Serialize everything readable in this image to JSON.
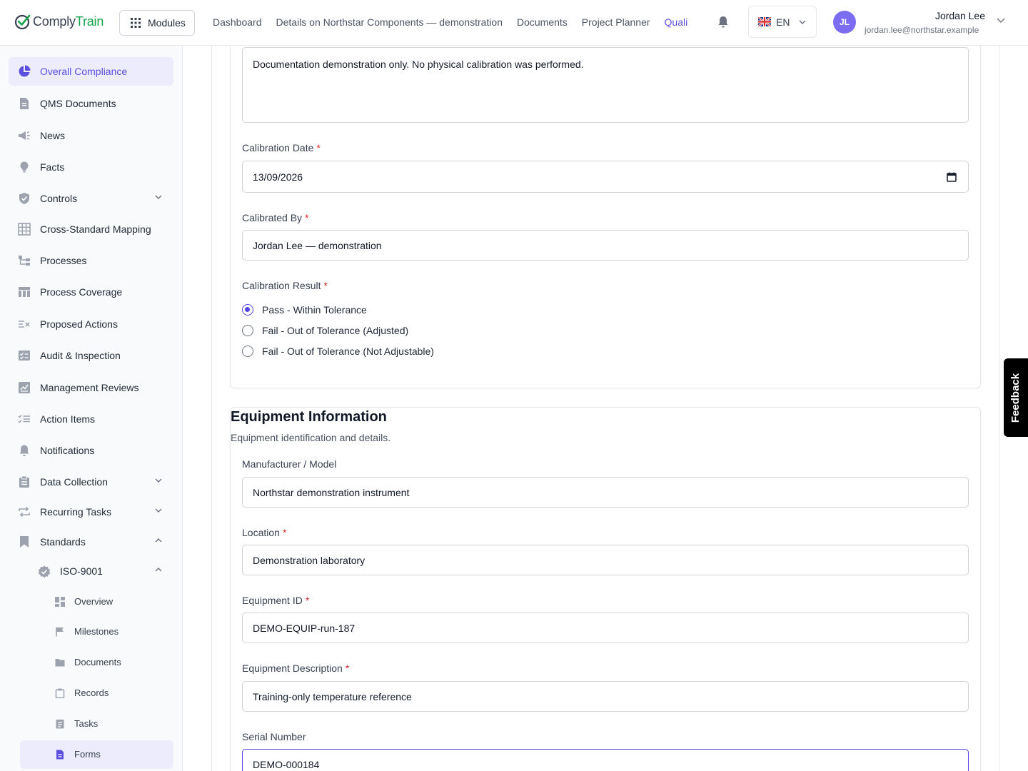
{
  "brand": {
    "name_part1": "Comply",
    "name_part2": "Train",
    "accent": "#16a34a"
  },
  "header": {
    "modules_label": "Modules",
    "nav": [
      "Dashboard",
      "Details on Northstar Components — demonstration",
      "Documents",
      "Project Planner",
      "Quali"
    ],
    "active_nav": "Quali",
    "language": "EN",
    "user": {
      "initials": "JL",
      "name": "Jordan Lee",
      "email": "jordan.lee@northstar.example"
    }
  },
  "sidebar": {
    "items": [
      {
        "label": "Overall Compliance",
        "icon": "pie-chart-icon",
        "active": true
      },
      {
        "label": "QMS Documents",
        "icon": "document-icon"
      },
      {
        "label": "News",
        "icon": "megaphone-icon"
      },
      {
        "label": "Facts",
        "icon": "lightbulb-icon"
      },
      {
        "label": "Controls",
        "icon": "shield-icon",
        "expandable": true
      },
      {
        "label": "Cross-Standard Mapping",
        "icon": "grid-icon"
      },
      {
        "label": "Processes",
        "icon": "flow-icon"
      },
      {
        "label": "Process Coverage",
        "icon": "table-icon"
      },
      {
        "label": "Proposed Actions",
        "icon": "list-x-icon"
      },
      {
        "label": "Audit & Inspection",
        "icon": "checklist-icon"
      },
      {
        "label": "Management Reviews",
        "icon": "chart-board-icon"
      },
      {
        "label": "Action Items",
        "icon": "tasks-icon"
      },
      {
        "label": "Notifications",
        "icon": "bell-icon"
      },
      {
        "label": "Data Collection",
        "icon": "clipboard-icon",
        "expandable": true
      },
      {
        "label": "Recurring Tasks",
        "icon": "repeat-icon",
        "expandable": true
      },
      {
        "label": "Standards",
        "icon": "bookmark-icon",
        "expanded": true
      }
    ],
    "standard": {
      "label": "ISO-9001",
      "icon": "badge-check-icon"
    },
    "standard_children": [
      {
        "label": "Overview",
        "icon": "dashboard-icon"
      },
      {
        "label": "Milestones",
        "icon": "flag-icon"
      },
      {
        "label": "Documents",
        "icon": "folder-icon"
      },
      {
        "label": "Records",
        "icon": "clipboard-icon"
      },
      {
        "label": "Tasks",
        "icon": "task-list-icon"
      },
      {
        "label": "Forms",
        "icon": "form-icon",
        "active": true
      }
    ]
  },
  "form": {
    "notes_value": "Documentation demonstration only. No physical calibration was performed.",
    "calibration_date": {
      "label": "Calibration Date",
      "value": "13/09/2026"
    },
    "calibrated_by": {
      "label": "Calibrated By",
      "value": "Jordan Lee — demonstration"
    },
    "calibration_result": {
      "label": "Calibration Result",
      "options": [
        "Pass - Within Tolerance",
        "Fail - Out of Tolerance (Adjusted)",
        "Fail - Out of Tolerance (Not Adjustable)"
      ],
      "selected": "Pass - Within Tolerance"
    },
    "equipment_section": {
      "title": "Equipment Information",
      "description": "Equipment identification and details."
    },
    "manufacturer_model": {
      "label": "Manufacturer / Model",
      "value": "Northstar demonstration instrument"
    },
    "location": {
      "label": "Location",
      "value": "Demonstration laboratory"
    },
    "equipment_id": {
      "label": "Equipment ID",
      "value": "DEMO-EQUIP-run-187"
    },
    "equipment_description": {
      "label": "Equipment Description",
      "value": "Training-only temperature reference"
    },
    "serial_number": {
      "label": "Serial Number",
      "value": "DEMO-000184"
    }
  },
  "feedback_label": "Feedback"
}
